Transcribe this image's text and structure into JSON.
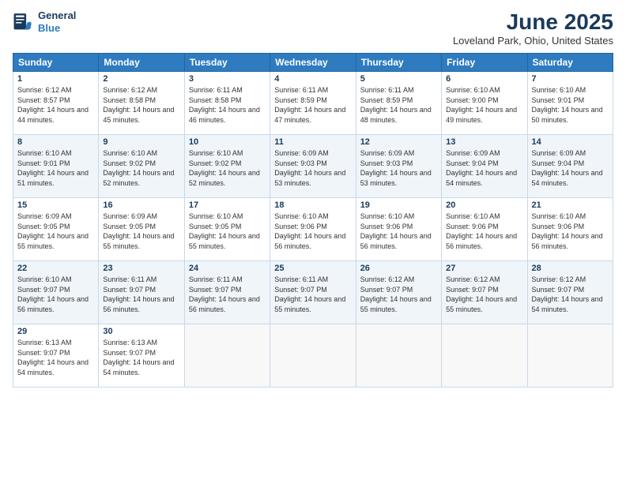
{
  "header": {
    "logo_line1": "General",
    "logo_line2": "Blue",
    "month_title": "June 2025",
    "location": "Loveland Park, Ohio, United States"
  },
  "weekdays": [
    "Sunday",
    "Monday",
    "Tuesday",
    "Wednesday",
    "Thursday",
    "Friday",
    "Saturday"
  ],
  "weeks": [
    [
      {
        "day": "1",
        "sunrise": "Sunrise: 6:12 AM",
        "sunset": "Sunset: 8:57 PM",
        "daylight": "Daylight: 14 hours and 44 minutes."
      },
      {
        "day": "2",
        "sunrise": "Sunrise: 6:12 AM",
        "sunset": "Sunset: 8:58 PM",
        "daylight": "Daylight: 14 hours and 45 minutes."
      },
      {
        "day": "3",
        "sunrise": "Sunrise: 6:11 AM",
        "sunset": "Sunset: 8:58 PM",
        "daylight": "Daylight: 14 hours and 46 minutes."
      },
      {
        "day": "4",
        "sunrise": "Sunrise: 6:11 AM",
        "sunset": "Sunset: 8:59 PM",
        "daylight": "Daylight: 14 hours and 47 minutes."
      },
      {
        "day": "5",
        "sunrise": "Sunrise: 6:11 AM",
        "sunset": "Sunset: 8:59 PM",
        "daylight": "Daylight: 14 hours and 48 minutes."
      },
      {
        "day": "6",
        "sunrise": "Sunrise: 6:10 AM",
        "sunset": "Sunset: 9:00 PM",
        "daylight": "Daylight: 14 hours and 49 minutes."
      },
      {
        "day": "7",
        "sunrise": "Sunrise: 6:10 AM",
        "sunset": "Sunset: 9:01 PM",
        "daylight": "Daylight: 14 hours and 50 minutes."
      }
    ],
    [
      {
        "day": "8",
        "sunrise": "Sunrise: 6:10 AM",
        "sunset": "Sunset: 9:01 PM",
        "daylight": "Daylight: 14 hours and 51 minutes."
      },
      {
        "day": "9",
        "sunrise": "Sunrise: 6:10 AM",
        "sunset": "Sunset: 9:02 PM",
        "daylight": "Daylight: 14 hours and 52 minutes."
      },
      {
        "day": "10",
        "sunrise": "Sunrise: 6:10 AM",
        "sunset": "Sunset: 9:02 PM",
        "daylight": "Daylight: 14 hours and 52 minutes."
      },
      {
        "day": "11",
        "sunrise": "Sunrise: 6:09 AM",
        "sunset": "Sunset: 9:03 PM",
        "daylight": "Daylight: 14 hours and 53 minutes."
      },
      {
        "day": "12",
        "sunrise": "Sunrise: 6:09 AM",
        "sunset": "Sunset: 9:03 PM",
        "daylight": "Daylight: 14 hours and 53 minutes."
      },
      {
        "day": "13",
        "sunrise": "Sunrise: 6:09 AM",
        "sunset": "Sunset: 9:04 PM",
        "daylight": "Daylight: 14 hours and 54 minutes."
      },
      {
        "day": "14",
        "sunrise": "Sunrise: 6:09 AM",
        "sunset": "Sunset: 9:04 PM",
        "daylight": "Daylight: 14 hours and 54 minutes."
      }
    ],
    [
      {
        "day": "15",
        "sunrise": "Sunrise: 6:09 AM",
        "sunset": "Sunset: 9:05 PM",
        "daylight": "Daylight: 14 hours and 55 minutes."
      },
      {
        "day": "16",
        "sunrise": "Sunrise: 6:09 AM",
        "sunset": "Sunset: 9:05 PM",
        "daylight": "Daylight: 14 hours and 55 minutes."
      },
      {
        "day": "17",
        "sunrise": "Sunrise: 6:10 AM",
        "sunset": "Sunset: 9:05 PM",
        "daylight": "Daylight: 14 hours and 55 minutes."
      },
      {
        "day": "18",
        "sunrise": "Sunrise: 6:10 AM",
        "sunset": "Sunset: 9:06 PM",
        "daylight": "Daylight: 14 hours and 56 minutes."
      },
      {
        "day": "19",
        "sunrise": "Sunrise: 6:10 AM",
        "sunset": "Sunset: 9:06 PM",
        "daylight": "Daylight: 14 hours and 56 minutes."
      },
      {
        "day": "20",
        "sunrise": "Sunrise: 6:10 AM",
        "sunset": "Sunset: 9:06 PM",
        "daylight": "Daylight: 14 hours and 56 minutes."
      },
      {
        "day": "21",
        "sunrise": "Sunrise: 6:10 AM",
        "sunset": "Sunset: 9:06 PM",
        "daylight": "Daylight: 14 hours and 56 minutes."
      }
    ],
    [
      {
        "day": "22",
        "sunrise": "Sunrise: 6:10 AM",
        "sunset": "Sunset: 9:07 PM",
        "daylight": "Daylight: 14 hours and 56 minutes."
      },
      {
        "day": "23",
        "sunrise": "Sunrise: 6:11 AM",
        "sunset": "Sunset: 9:07 PM",
        "daylight": "Daylight: 14 hours and 56 minutes."
      },
      {
        "day": "24",
        "sunrise": "Sunrise: 6:11 AM",
        "sunset": "Sunset: 9:07 PM",
        "daylight": "Daylight: 14 hours and 56 minutes."
      },
      {
        "day": "25",
        "sunrise": "Sunrise: 6:11 AM",
        "sunset": "Sunset: 9:07 PM",
        "daylight": "Daylight: 14 hours and 55 minutes."
      },
      {
        "day": "26",
        "sunrise": "Sunrise: 6:12 AM",
        "sunset": "Sunset: 9:07 PM",
        "daylight": "Daylight: 14 hours and 55 minutes."
      },
      {
        "day": "27",
        "sunrise": "Sunrise: 6:12 AM",
        "sunset": "Sunset: 9:07 PM",
        "daylight": "Daylight: 14 hours and 55 minutes."
      },
      {
        "day": "28",
        "sunrise": "Sunrise: 6:12 AM",
        "sunset": "Sunset: 9:07 PM",
        "daylight": "Daylight: 14 hours and 54 minutes."
      }
    ],
    [
      {
        "day": "29",
        "sunrise": "Sunrise: 6:13 AM",
        "sunset": "Sunset: 9:07 PM",
        "daylight": "Daylight: 14 hours and 54 minutes."
      },
      {
        "day": "30",
        "sunrise": "Sunrise: 6:13 AM",
        "sunset": "Sunset: 9:07 PM",
        "daylight": "Daylight: 14 hours and 54 minutes."
      },
      null,
      null,
      null,
      null,
      null
    ]
  ]
}
